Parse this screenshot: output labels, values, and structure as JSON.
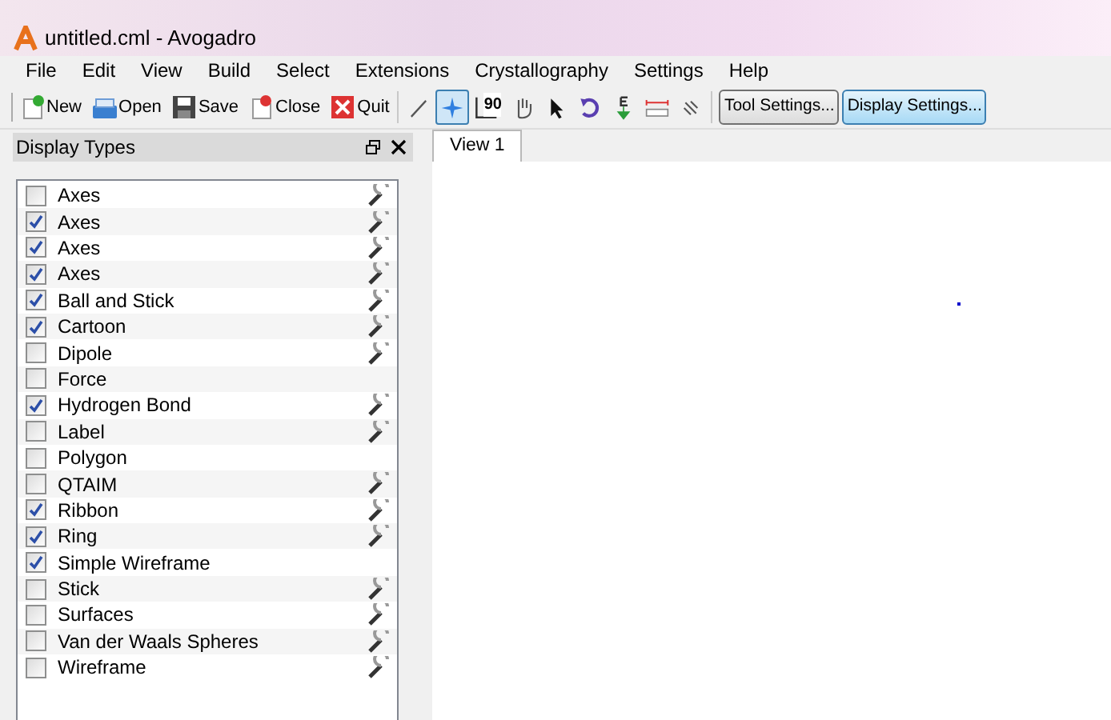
{
  "window": {
    "title": "untitled.cml - Avogadro"
  },
  "menu": [
    "File",
    "Edit",
    "View",
    "Build",
    "Select",
    "Extensions",
    "Crystallography",
    "Settings",
    "Help"
  ],
  "file_toolbar": [
    {
      "kind": "new",
      "label": "New"
    },
    {
      "kind": "open",
      "label": "Open"
    },
    {
      "kind": "save",
      "label": "Save"
    },
    {
      "kind": "close",
      "label": "Close"
    },
    {
      "kind": "quit",
      "label": "Quit"
    }
  ],
  "tools": [
    {
      "kind": "draw",
      "selected": false
    },
    {
      "kind": "navigate",
      "selected": true
    },
    {
      "kind": "measure",
      "selected": false,
      "label": "90"
    },
    {
      "kind": "manipulate",
      "selected": false
    },
    {
      "kind": "select",
      "selected": false
    },
    {
      "kind": "rotate",
      "selected": false
    },
    {
      "kind": "optimize",
      "selected": false
    },
    {
      "kind": "ruler",
      "selected": false
    },
    {
      "kind": "align",
      "selected": false
    }
  ],
  "settings_buttons": [
    {
      "label": "Tool Settings...",
      "selected": false
    },
    {
      "label": "Display Settings...",
      "selected": true
    }
  ],
  "dock": {
    "title": "Display Types"
  },
  "display_types": [
    {
      "label": "Axes",
      "checked": false,
      "settings": true
    },
    {
      "label": "Axes",
      "checked": true,
      "settings": true
    },
    {
      "label": "Axes",
      "checked": true,
      "settings": true
    },
    {
      "label": "Axes",
      "checked": true,
      "settings": true
    },
    {
      "label": "Ball and Stick",
      "checked": true,
      "settings": true
    },
    {
      "label": "Cartoon",
      "checked": true,
      "settings": true
    },
    {
      "label": "Dipole",
      "checked": false,
      "settings": true
    },
    {
      "label": "Force",
      "checked": false,
      "settings": false
    },
    {
      "label": "Hydrogen Bond",
      "checked": true,
      "settings": true
    },
    {
      "label": "Label",
      "checked": false,
      "settings": true
    },
    {
      "label": "Polygon",
      "checked": false,
      "settings": false
    },
    {
      "label": "QTAIM",
      "checked": false,
      "settings": true
    },
    {
      "label": "Ribbon",
      "checked": true,
      "settings": true
    },
    {
      "label": "Ring",
      "checked": true,
      "settings": true
    },
    {
      "label": "Simple Wireframe",
      "checked": true,
      "settings": false
    },
    {
      "label": "Stick",
      "checked": false,
      "settings": true
    },
    {
      "label": "Surfaces",
      "checked": false,
      "settings": true
    },
    {
      "label": "Van der Waals Spheres",
      "checked": false,
      "settings": true
    },
    {
      "label": "Wireframe",
      "checked": false,
      "settings": true
    }
  ],
  "view_tabs": [
    {
      "label": "View 1",
      "selected": true
    }
  ]
}
